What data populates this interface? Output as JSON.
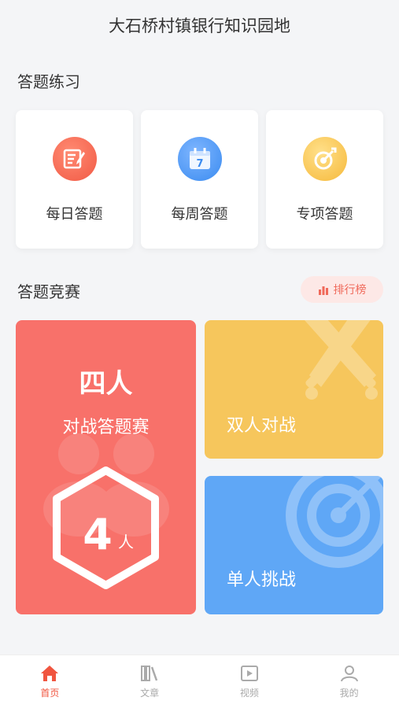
{
  "header": {
    "title": "大石桥村镇银行知识园地"
  },
  "practice": {
    "section_title": "答题练习",
    "items": [
      {
        "label": "每日答题",
        "icon": "edit-icon"
      },
      {
        "label": "每周答题",
        "icon": "calendar-icon"
      },
      {
        "label": "专项答题",
        "icon": "target-icon"
      }
    ]
  },
  "contest": {
    "section_title": "答题竞赛",
    "rank_label": "排行榜",
    "four_player": {
      "title": "四人",
      "subtitle": "对战答题赛",
      "badge_number": "4",
      "badge_unit": "人"
    },
    "duo": {
      "label": "双人对战"
    },
    "solo": {
      "label": "单人挑战"
    }
  },
  "tabbar": {
    "items": [
      {
        "label": "首页",
        "icon": "home-icon",
        "active": true
      },
      {
        "label": "文章",
        "icon": "books-icon",
        "active": false
      },
      {
        "label": "视频",
        "icon": "video-icon",
        "active": false
      },
      {
        "label": "我的",
        "icon": "user-icon",
        "active": false
      }
    ]
  },
  "colors": {
    "accent_red": "#f0553f",
    "four_card": "#f8716a",
    "duo_card": "#f6c65c",
    "solo_card": "#5fa7f6"
  }
}
